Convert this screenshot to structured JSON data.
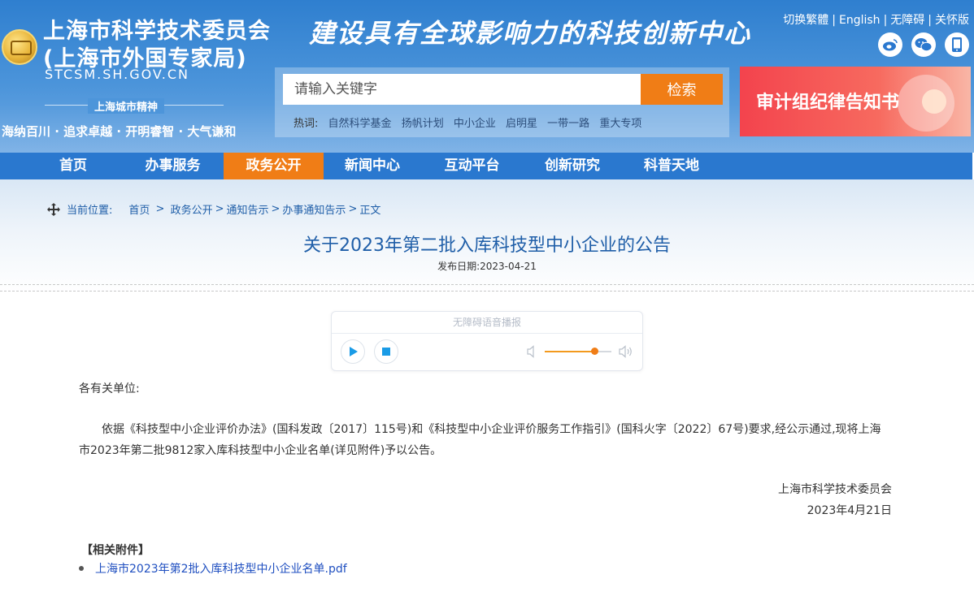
{
  "header": {
    "title_line1": "上海市科学技术委员会",
    "title_line2": "(上海市外国专家局)",
    "domain": "STCSM.SH.GOV.CN",
    "spirit_title": "上海城市精神",
    "spirit_text": "海纳百川 · 追求卓越 · 开明睿智 · 大气谦和",
    "slogan": "建设具有全球影响力的科技创新中心",
    "top_links": [
      "切换繁體",
      "English",
      "无障碍",
      "关怀版"
    ],
    "social_icons": [
      "weibo-icon",
      "wechat-icon",
      "mobile-icon"
    ]
  },
  "search": {
    "placeholder": "请输入关键字",
    "button_label": "检索",
    "hot_label": "热词:",
    "hot_words": [
      "自然科学基金",
      "扬帆计划",
      "中小企业",
      "启明星",
      "一带一路",
      "重大专项"
    ]
  },
  "banner": {
    "text": "审计组纪律告知书"
  },
  "nav": {
    "items": [
      "首页",
      "办事服务",
      "政务公开",
      "新闻中心",
      "互动平台",
      "创新研究",
      "科普天地"
    ],
    "active": "政务公开"
  },
  "breadcrumb": {
    "label": "当前位置:",
    "items": [
      "首页",
      "政务公开",
      "通知告示",
      "办事通知告示",
      "正文"
    ]
  },
  "article": {
    "title": "关于2023年第二批入库科技型中小企业的公告",
    "publish_date": "发布日期:2023-04-21",
    "salutation": "各有关单位:",
    "paragraph": "依据《科技型中小企业评价办法》(国科发政〔2017〕115号)和《科技型中小企业评价服务工作指引》(国科火字〔2022〕67号)要求,经公示通过,现将上海市2023年第二批9812家入库科技型中小企业名单(详见附件)予以公告。",
    "sign_org": "上海市科学技术委员会",
    "sign_date": "2023年4月21日"
  },
  "audio": {
    "title": "无障碍语音播报",
    "volume": 0.75
  },
  "attachments": {
    "title": "【相关附件】",
    "files": [
      "上海市2023年第2批入库科技型中小企业名单.pdf"
    ]
  },
  "colors": {
    "primary_blue": "#2a78cf",
    "accent_orange": "#f07d16",
    "link_blue": "#1f5ea8",
    "banner_red": "#f3434d"
  }
}
